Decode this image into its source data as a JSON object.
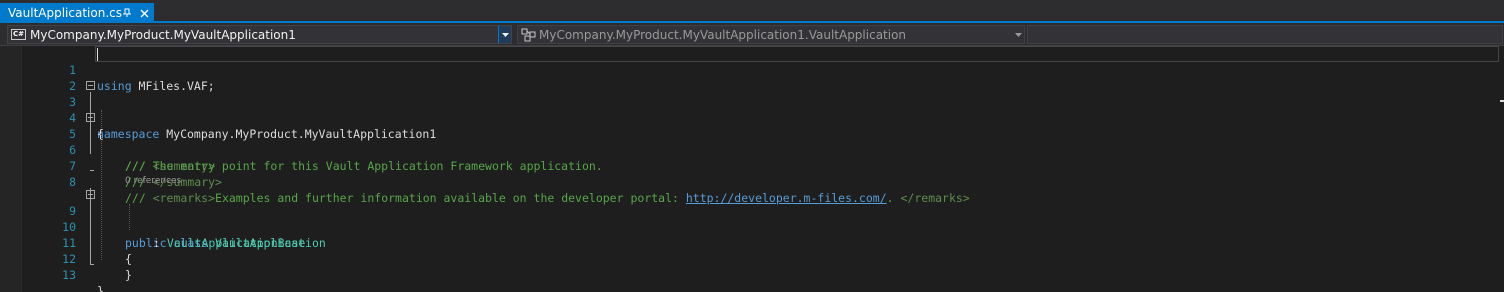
{
  "tabs": [
    {
      "title": "VaultApplication.cs",
      "active": true
    }
  ],
  "icons": {
    "pin": "pin-icon",
    "close": "close-icon",
    "csharp": "csharp-file-icon",
    "class": "class-icon",
    "dropdown": "chevron-down-icon"
  },
  "navbar": {
    "project_badge": "C#",
    "project": "MyCompany.MyProduct.MyVaultApplication1",
    "type": "MyCompany.MyProduct.MyVaultApplication1.VaultApplication",
    "member": ""
  },
  "editor": {
    "line_numbers": [
      "1",
      "2",
      "3",
      "4",
      "5",
      "6",
      "7",
      "8",
      "9",
      "10",
      "11",
      "12",
      "13"
    ],
    "codelens": "0 references",
    "lines": {
      "l1_kw": "using",
      "l1_rest": " MFiles.VAF;",
      "l3_kw": "namespace",
      "l3_rest": " MyCompany.MyProduct.MyVaultApplication1",
      "l4": "{",
      "l5_slashes": "///",
      "l5_tag": " <summary>",
      "l6": "/// The entry point for this Vault Application Framework application.",
      "l7_slashes": "///",
      "l7_tag": " </summary>",
      "l8_slashes": "///",
      "l8_open": " <remarks>",
      "l8_text": "Examples and further information available on the developer portal: ",
      "l8_link": "http://developer.m-files.com/",
      "l8_text2": ". ",
      "l8_close": "</remarks>",
      "l9_kw1": "public",
      "l9_kw2": "class",
      "l9_type": "VaultApplication",
      "l10_colon": ": ",
      "l10_type": "VaultApplicationBase",
      "l11": "{",
      "l12": "}",
      "l13": "}"
    }
  },
  "colors": {
    "accent": "#007acc",
    "keyword": "#569cd6",
    "type": "#4ec9b0",
    "comment": "#57a64a",
    "line_number": "#2b91af",
    "background": "#1e1e1e"
  }
}
